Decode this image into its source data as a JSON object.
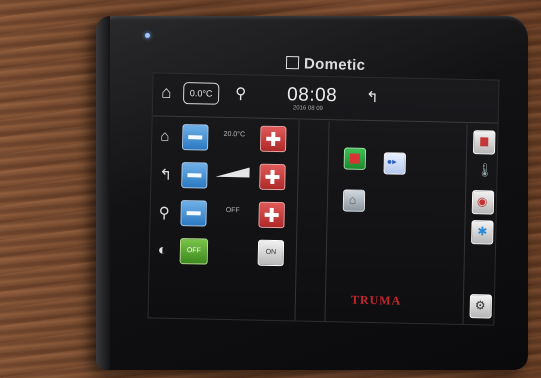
{
  "device": {
    "brand": "Dometic"
  },
  "topbar": {
    "temperature_mode": "0.0°C",
    "time": "08:08",
    "date": "2016 08 09"
  },
  "rows": [
    {
      "icon": "home-icon",
      "value": "20.0°C"
    },
    {
      "icon": "fan-icon",
      "value": ""
    },
    {
      "icon": "plug-icon",
      "value": "OFF"
    }
  ],
  "bottom_row": {
    "off_label": "OFF",
    "on_label": "ON"
  },
  "panel": {
    "logo": "TRUMA"
  },
  "colors": {
    "minus": "#2a79c2",
    "plus": "#b02828",
    "off": "#3c8a1e",
    "logo": "#c2262e"
  }
}
